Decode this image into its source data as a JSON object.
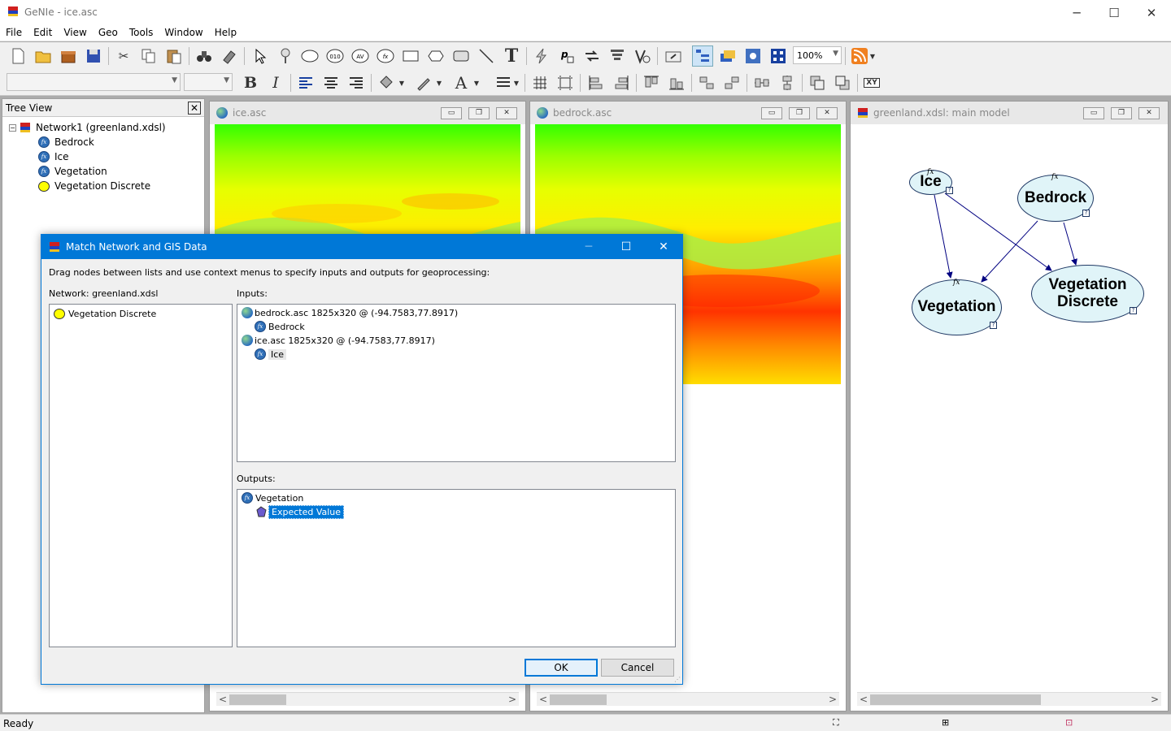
{
  "window": {
    "title": "GeNIe - ice.asc",
    "min": "─",
    "max": "☐",
    "close": "✕"
  },
  "menu": [
    "File",
    "Edit",
    "View",
    "Geo",
    "Tools",
    "Window",
    "Help"
  ],
  "toolbar": {
    "zoom": "100%",
    "xy_label": "XY",
    "bold": "B",
    "italic": "I",
    "font_a": "A",
    "text_t": "T"
  },
  "tree_view": {
    "title": "Tree View",
    "close": "✕",
    "root": "Network1 (greenland.xdsl)",
    "items": [
      "Bedrock",
      "Ice",
      "Vegetation",
      "Vegetation Discrete"
    ],
    "expander": "−"
  },
  "mdi": {
    "ice": {
      "title": "ice.asc"
    },
    "bedrock": {
      "title": "bedrock.asc"
    },
    "model": {
      "title": "greenland.xdsl: main model"
    },
    "btn_min": "▭",
    "btn_restore": "❐",
    "btn_close": "✕",
    "left": "<",
    "right": ">"
  },
  "network": {
    "nodes": [
      {
        "id": "ice",
        "label": "Ice"
      },
      {
        "id": "bedrock",
        "label": "Bedrock"
      },
      {
        "id": "vegetation",
        "label": "Vegetation"
      },
      {
        "id": "vegdisc",
        "label": "Vegetation Discrete"
      }
    ],
    "fx": "fx",
    "q": "?"
  },
  "dialog": {
    "title": "Match Network and GIS Data",
    "instruction": "Drag nodes between lists and use context menus to specify inputs and outputs for geoprocessing:",
    "network_label": "Network: greenland.xdsl",
    "network_items": [
      "Vegetation Discrete"
    ],
    "inputs_label": "Inputs:",
    "inputs": [
      {
        "file": "bedrock.asc 1825x320 @ (-94.7583,77.8917)",
        "node": "Bedrock"
      },
      {
        "file": "ice.asc 1825x320 @ (-94.7583,77.8917)",
        "node": "Ice"
      }
    ],
    "outputs_label": "Outputs:",
    "outputs": [
      {
        "node": "Vegetation",
        "value": "Expected Value"
      }
    ],
    "ok": "OK",
    "cancel": "Cancel"
  },
  "status": {
    "text": "Ready"
  },
  "colors": {
    "accent": "#0078d7",
    "node_fill": "#e0f4f8",
    "node_border": "#1f3864",
    "raster_green": "#33ff00",
    "raster_yellow": "#ffff00",
    "raster_red": "#ff3300"
  }
}
